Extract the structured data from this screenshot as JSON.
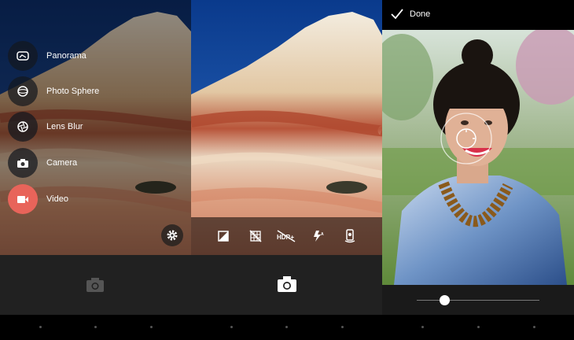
{
  "mode_menu": {
    "items": [
      {
        "label": "Panorama",
        "icon": "panorama-icon",
        "active": false
      },
      {
        "label": "Photo Sphere",
        "icon": "photo-sphere-icon",
        "active": false
      },
      {
        "label": "Lens Blur",
        "icon": "lens-blur-icon",
        "active": false
      },
      {
        "label": "Camera",
        "icon": "camera-icon",
        "active": false
      },
      {
        "label": "Video",
        "icon": "video-icon",
        "active": true
      }
    ],
    "settings_icon": "gear-icon"
  },
  "options_strip": {
    "icons": [
      "exposure-icon",
      "grid-off-icon",
      "hdr-off-icon",
      "flash-auto-icon",
      "camera-switch-icon"
    ],
    "hdr_text": "HDR+"
  },
  "lens_blur_editor": {
    "done_label": "Done",
    "blur_level": 0.23
  },
  "colors": {
    "accent": "#e8645a",
    "bottom_bar": "#212121",
    "nav_bar": "#000000"
  }
}
